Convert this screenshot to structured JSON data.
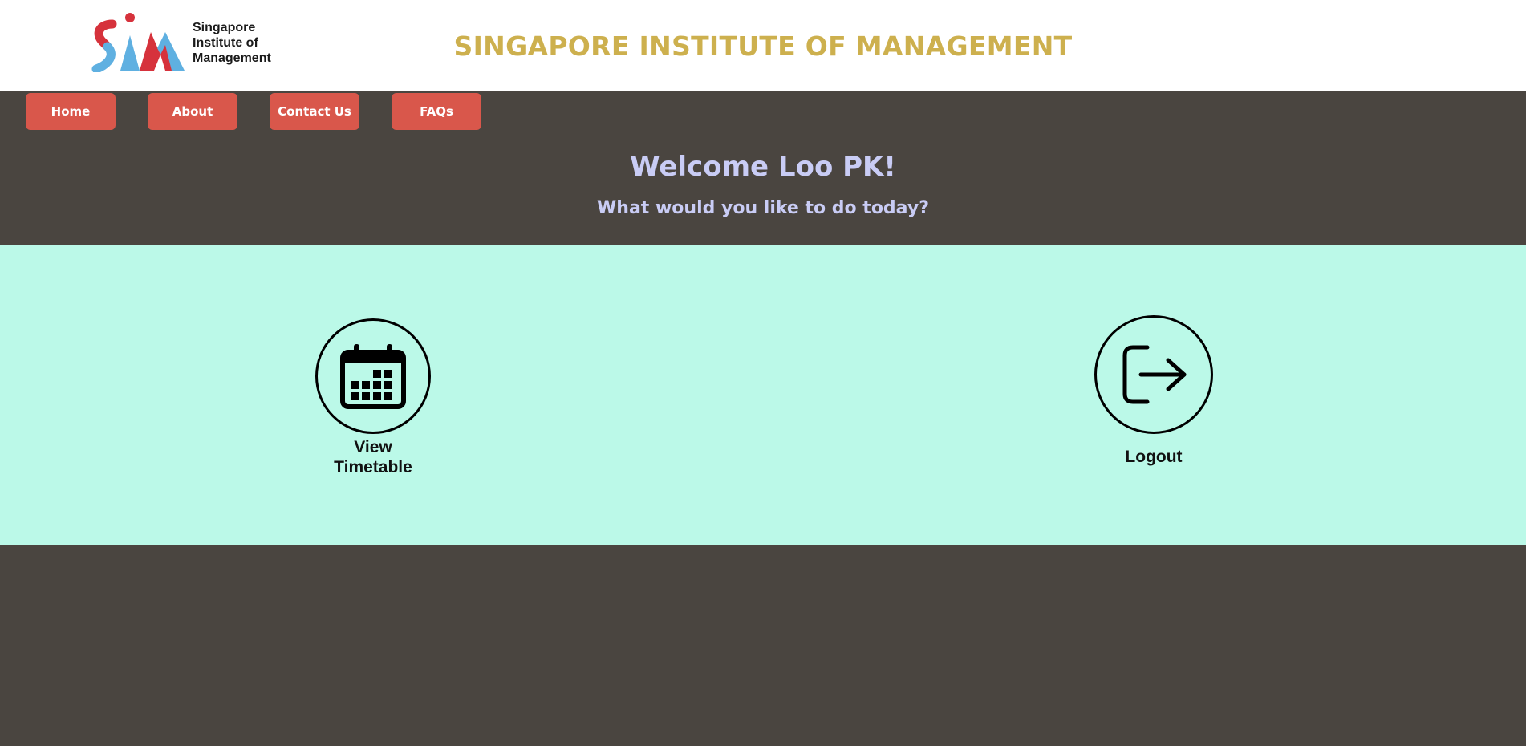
{
  "header": {
    "logo": {
      "line1": "Singapore",
      "line2": "Institute of",
      "line3": "Management",
      "icon": "sim-logo-icon",
      "colors": {
        "red": "#d6323c",
        "blue": "#5fb0e1"
      }
    },
    "site_title": "SINGAPORE INSTITUTE OF MANAGEMENT"
  },
  "nav": {
    "items": [
      {
        "label": "Home"
      },
      {
        "label": "About"
      },
      {
        "label": "Contact Us"
      },
      {
        "label": "FAQs"
      }
    ]
  },
  "main": {
    "welcome": "Welcome Loo PK!",
    "prompt": "What would you like to do today?"
  },
  "actions": {
    "timetable": {
      "label_line1": "View",
      "label_line2": "Timetable",
      "icon": "calendar-icon"
    },
    "logout": {
      "label": "Logout",
      "icon": "logout-icon"
    }
  },
  "colors": {
    "background": "#4a4540",
    "header": "#ffffff",
    "title": "#cdb04e",
    "nav_button": "#d9574b",
    "welcome_text": "#c9ccf5",
    "actions_panel": "#bbf9e8"
  }
}
